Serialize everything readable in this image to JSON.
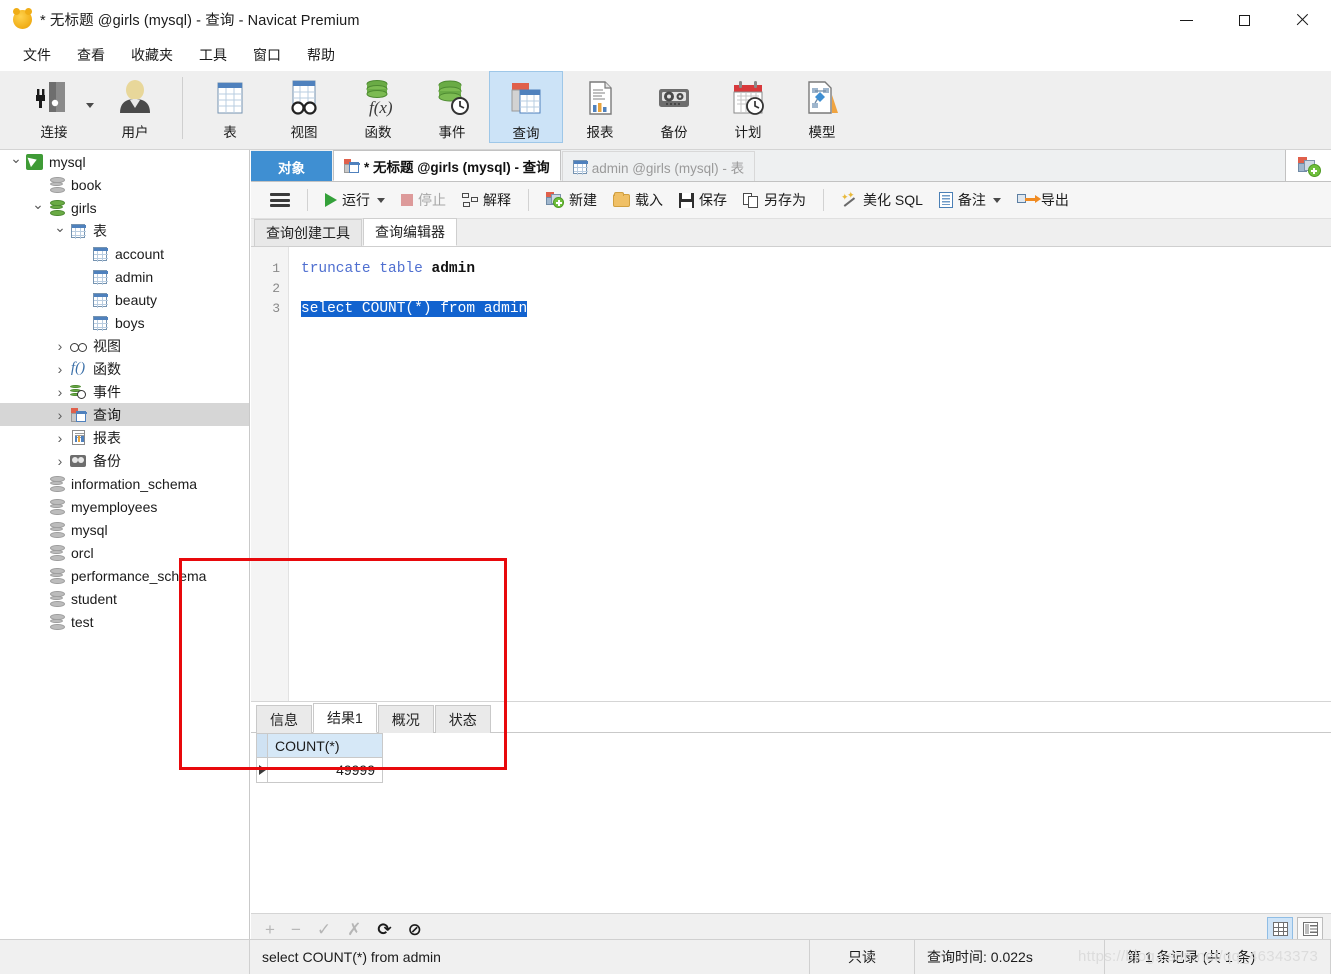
{
  "window": {
    "title": "* 无标题 @girls (mysql) - 查询 - Navicat Premium",
    "minimize_label": "—",
    "maximize_label": "□",
    "close_label": "✕"
  },
  "menu": {
    "items": [
      {
        "label": "文件"
      },
      {
        "label": "查看"
      },
      {
        "label": "收藏夹"
      },
      {
        "label": "工具"
      },
      {
        "label": "窗口"
      },
      {
        "label": "帮助"
      }
    ]
  },
  "toolbar": {
    "items": [
      {
        "label": "连接",
        "icon": "connection-icon",
        "has_caret": true
      },
      {
        "label": "用户",
        "icon": "user-icon",
        "has_caret": false
      },
      {
        "label": "表",
        "icon": "table-icon",
        "has_caret": false
      },
      {
        "label": "视图",
        "icon": "view-icon",
        "has_caret": false
      },
      {
        "label": "函数",
        "icon": "function-icon",
        "has_caret": false
      },
      {
        "label": "事件",
        "icon": "event-icon",
        "has_caret": false
      },
      {
        "label": "查询",
        "icon": "query-icon",
        "has_caret": false,
        "active": true
      },
      {
        "label": "报表",
        "icon": "report-icon",
        "has_caret": false
      },
      {
        "label": "备份",
        "icon": "backup-icon",
        "has_caret": false
      },
      {
        "label": "计划",
        "icon": "schedule-icon",
        "has_caret": false
      },
      {
        "label": "模型",
        "icon": "model-icon",
        "has_caret": false
      }
    ]
  },
  "sidebar": {
    "tree": [
      {
        "label": "mysql",
        "indent": 0,
        "chev": "open",
        "icon": "navicat-connection-icon"
      },
      {
        "label": "book",
        "indent": 1,
        "chev": "blank",
        "icon": "database-icon"
      },
      {
        "label": "girls",
        "indent": 1,
        "chev": "open",
        "icon": "database-active-icon"
      },
      {
        "label": "表",
        "indent": 2,
        "chev": "open",
        "icon": "table-folder-icon"
      },
      {
        "label": "account",
        "indent": 3,
        "chev": "blank",
        "icon": "table-icon"
      },
      {
        "label": "admin",
        "indent": 3,
        "chev": "blank",
        "icon": "table-icon"
      },
      {
        "label": "beauty",
        "indent": 3,
        "chev": "blank",
        "icon": "table-icon"
      },
      {
        "label": "boys",
        "indent": 3,
        "chev": "blank",
        "icon": "table-icon"
      },
      {
        "label": "视图",
        "indent": 2,
        "chev": "closed",
        "icon": "view-icon"
      },
      {
        "label": "函数",
        "indent": 2,
        "chev": "closed",
        "icon": "function-icon"
      },
      {
        "label": "事件",
        "indent": 2,
        "chev": "closed",
        "icon": "event-icon"
      },
      {
        "label": "查询",
        "indent": 2,
        "chev": "closed",
        "icon": "query-icon",
        "selected": true
      },
      {
        "label": "报表",
        "indent": 2,
        "chev": "closed",
        "icon": "report-icon"
      },
      {
        "label": "备份",
        "indent": 2,
        "chev": "closed",
        "icon": "backup-icon"
      },
      {
        "label": "information_schema",
        "indent": 1,
        "chev": "blank",
        "icon": "database-icon"
      },
      {
        "label": "myemployees",
        "indent": 1,
        "chev": "blank",
        "icon": "database-icon"
      },
      {
        "label": "mysql",
        "indent": 1,
        "chev": "blank",
        "icon": "database-icon"
      },
      {
        "label": "orcl",
        "indent": 1,
        "chev": "blank",
        "icon": "database-icon"
      },
      {
        "label": "performance_schema",
        "indent": 1,
        "chev": "blank",
        "icon": "database-icon"
      },
      {
        "label": "student",
        "indent": 1,
        "chev": "blank",
        "icon": "database-icon"
      },
      {
        "label": "test",
        "indent": 1,
        "chev": "blank",
        "icon": "database-icon"
      }
    ]
  },
  "tabs": [
    {
      "label": "对象",
      "state": "objects"
    },
    {
      "label": "* 无标题 @girls (mysql) - 查询",
      "state": "active",
      "icon": "query-icon"
    },
    {
      "label": "admin @girls (mysql) - 表",
      "state": "inactive",
      "icon": "table-icon"
    }
  ],
  "query_toolbar": {
    "menu_icon": "hamburger-icon",
    "buttons": [
      {
        "label": "运行",
        "icon": "play-icon",
        "has_caret": true,
        "disabled": false
      },
      {
        "label": "停止",
        "icon": "stop-icon",
        "has_caret": false,
        "disabled": true
      },
      {
        "label": "解释",
        "icon": "explain-icon",
        "has_caret": false,
        "disabled": false
      },
      {
        "label": "新建",
        "icon": "new-query-icon",
        "has_caret": false,
        "disabled": false
      },
      {
        "label": "载入",
        "icon": "folder-icon",
        "has_caret": false,
        "disabled": false
      },
      {
        "label": "保存",
        "icon": "save-icon",
        "has_caret": false,
        "disabled": false
      },
      {
        "label": "另存为",
        "icon": "save-as-icon",
        "has_caret": false,
        "disabled": false
      },
      {
        "label": "美化 SQL",
        "icon": "magic-wand-icon",
        "has_caret": false,
        "disabled": false
      },
      {
        "label": "备注",
        "icon": "note-icon",
        "has_caret": true,
        "disabled": false
      },
      {
        "label": "导出",
        "icon": "export-icon",
        "has_caret": false,
        "disabled": false
      }
    ]
  },
  "sub_tabs": [
    {
      "label": "查询创建工具",
      "active": false
    },
    {
      "label": "查询编辑器",
      "active": true
    }
  ],
  "editor": {
    "line_numbers": [
      "1",
      "2",
      "3"
    ],
    "lines": [
      {
        "number": "1",
        "keyword": "truncate table",
        "ident": " admin",
        "selected": false
      },
      {
        "number": "2",
        "text": "",
        "selected": false
      },
      {
        "number": "3",
        "text": "select COUNT(*) from admin",
        "selected": true
      }
    ]
  },
  "result_tabs": [
    {
      "label": "信息",
      "active": false
    },
    {
      "label": "结果1",
      "active": true
    },
    {
      "label": "概况",
      "active": false
    },
    {
      "label": "状态",
      "active": false
    }
  ],
  "result_grid": {
    "columns": [
      "COUNT(*)"
    ],
    "rows": [
      [
        "49999"
      ]
    ]
  },
  "grid_toolbar": {
    "add": "+",
    "remove": "−",
    "confirm": "✓",
    "cancel": "✗",
    "refresh": "⟳",
    "stop": "⊘"
  },
  "view_toggle": {
    "grid_label": "grid-view",
    "form_label": "form-view",
    "active": "grid-view"
  },
  "status_bar": {
    "query": "select COUNT(*) from admin",
    "readonly": "只读",
    "query_time": "查询时间: 0.022s",
    "record_info": "第 1 条记录 (共 1 条)"
  },
  "watermark": "https://blog.csdn.net/qq_46343373",
  "colors": {
    "accent_blue": "#3f8fd2",
    "selection_blue": "#1263cf",
    "annotation_red": "#e8090c",
    "keyword_blue": "#4f6fd0",
    "header_cell": "#d6e8f7"
  }
}
